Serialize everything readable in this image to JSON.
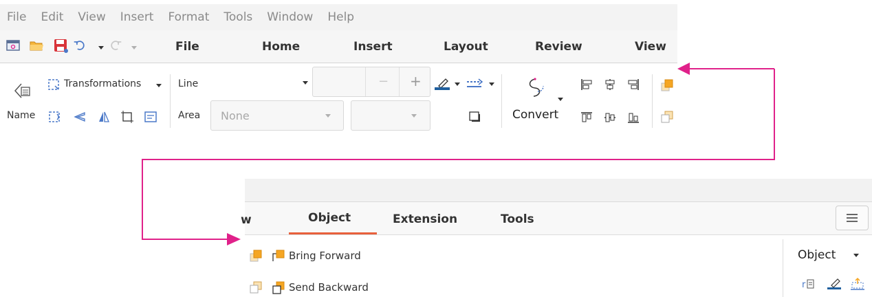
{
  "menu": [
    "File",
    "Edit",
    "View",
    "Insert",
    "Format",
    "Tools",
    "Window",
    "Help"
  ],
  "ribbon_tabs": {
    "file": "File",
    "home": "Home",
    "insert": "Insert",
    "layout": "Layout",
    "review": "Review",
    "view": "View"
  },
  "quick_icons": [
    "new-document-icon",
    "open-folder-icon",
    "save-icon",
    "undo-icon",
    "redo-icon"
  ],
  "ribbon": {
    "transformations_label": "Transformations",
    "name_label": "Name",
    "line_label": "Line",
    "area_label": "Area",
    "area_value": "None",
    "convert_label": "Convert",
    "line_width_decrement": "−",
    "line_width_increment": "+"
  },
  "bottom_tabs": {
    "partial": "w",
    "object": "Object",
    "extension": "Extension",
    "tools": "Tools"
  },
  "bottom": {
    "bring_forward": "Bring Forward",
    "send_backward": "Send Backward",
    "object_menu": "Object"
  },
  "colors": {
    "accent_arrow": "#e0218a",
    "active_tab_underline": "#e8603c",
    "arrange_orange": "#f5a623",
    "line_blue": "#1f5f9e"
  }
}
